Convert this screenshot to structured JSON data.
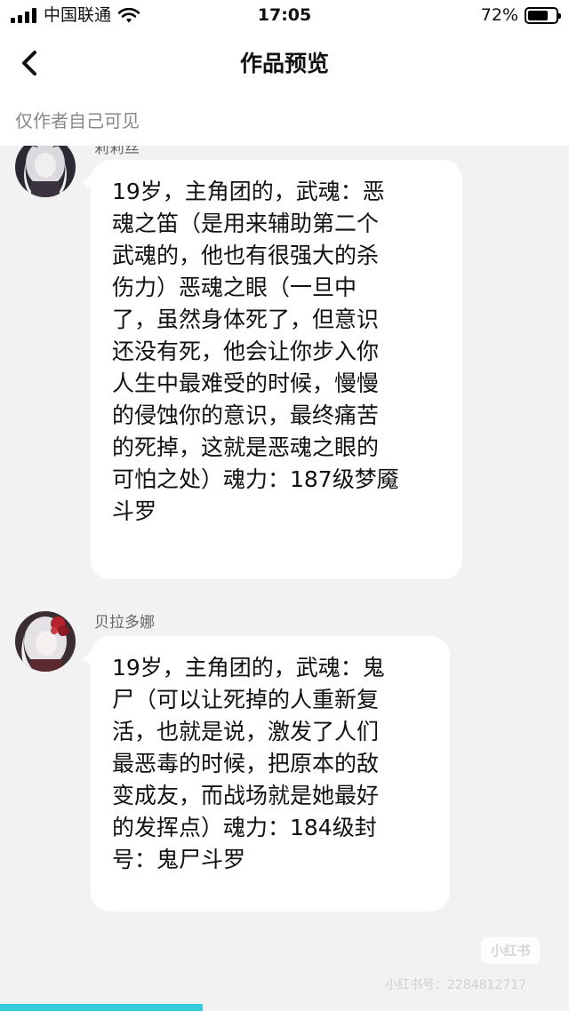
{
  "status_bar": {
    "carrier": "中国联通",
    "time": "17:05",
    "battery_percent": "72%",
    "battery_level": 0.72,
    "signal_bars": 4
  },
  "nav": {
    "title": "作品预览",
    "back_icon": "chevron-left-icon"
  },
  "visibility_note": "仅作者自己可见",
  "messages": [
    {
      "author": "莉莉丝",
      "avatar_icon": "character-avatar",
      "lines": [
        "19岁，主角团的，武魂：恶",
        "魂之笛（是用来辅助第二个",
        "武魂的，他也有很强大的杀",
        "伤力）恶魂之眼（一旦中",
        "了，虽然身体死了，但意识",
        "还没有死，他会让你步入你",
        "人生中最难受的时候，慢慢",
        "的侵蚀你的意识，最终痛苦",
        "的死掉，这就是恶魂之眼的",
        "可怕之处）魂力：187级梦魇",
        "斗罗"
      ]
    },
    {
      "author": "贝拉多娜",
      "avatar_icon": "character-avatar",
      "lines": [
        "19岁，主角团的，武魂：鬼",
        "尸（可以让死掉的人重新复",
        "活，也就是说，激发了人们",
        "最恶毒的时候，把原本的敌",
        "变成友，而战场就是她最好",
        "的发挥点）魂力：184级封",
        "号：鬼尸斗罗"
      ]
    }
  ],
  "watermark": {
    "logo": "小红书",
    "text": "小红书号：2284812717"
  },
  "colors": {
    "background": "#f2f2f2",
    "bubble": "#ffffff",
    "secondary_text": "#888888",
    "scroll_indicator": "#33ccd8"
  }
}
